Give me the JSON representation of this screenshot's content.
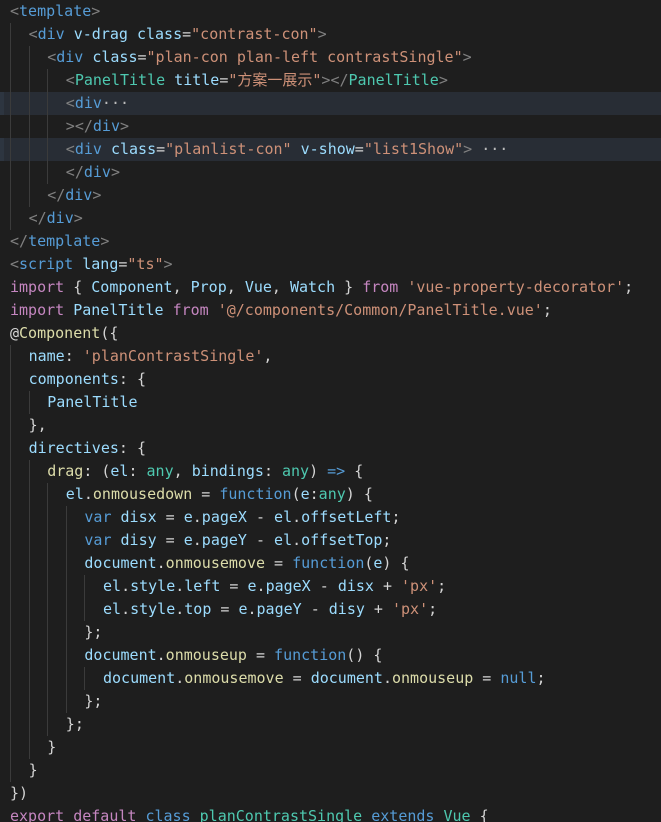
{
  "editor": {
    "lines": [
      {
        "indent": 0,
        "tokens": [
          [
            "punc",
            "<"
          ],
          [
            "tag",
            "template"
          ],
          [
            "punc",
            ">"
          ]
        ]
      },
      {
        "indent": 1,
        "tokens": [
          [
            "punc",
            "<"
          ],
          [
            "tag",
            "div"
          ],
          [
            "plain",
            " "
          ],
          [
            "attr",
            "v-drag"
          ],
          [
            "plain",
            " "
          ],
          [
            "attr",
            "class"
          ],
          [
            "plain",
            "="
          ],
          [
            "str",
            "\"contrast-con\""
          ],
          [
            "punc",
            ">"
          ]
        ]
      },
      {
        "indent": 2,
        "tokens": [
          [
            "punc",
            "<"
          ],
          [
            "tag",
            "div"
          ],
          [
            "plain",
            " "
          ],
          [
            "attr",
            "class"
          ],
          [
            "plain",
            "="
          ],
          [
            "str",
            "\"plan-con plan-left contrastSingle\""
          ],
          [
            "punc",
            ">"
          ]
        ]
      },
      {
        "indent": 3,
        "tokens": [
          [
            "punc",
            "<"
          ],
          [
            "comp",
            "PanelTitle"
          ],
          [
            "plain",
            " "
          ],
          [
            "attr",
            "title"
          ],
          [
            "plain",
            "="
          ],
          [
            "str",
            "\"方案一展示\""
          ],
          [
            "punc",
            "></"
          ],
          [
            "comp",
            "PanelTitle"
          ],
          [
            "punc",
            ">"
          ]
        ]
      },
      {
        "indent": 3,
        "current": true,
        "tokens": [
          [
            "punc",
            "<"
          ],
          [
            "tag",
            "div"
          ],
          [
            "fold",
            "···"
          ]
        ]
      },
      {
        "indent": 3,
        "tokens": [
          [
            "punc",
            "></"
          ],
          [
            "tag",
            "div"
          ],
          [
            "punc",
            ">"
          ]
        ]
      },
      {
        "indent": 3,
        "current": true,
        "tokens": [
          [
            "punc",
            "<"
          ],
          [
            "tag",
            "div"
          ],
          [
            "plain",
            " "
          ],
          [
            "attr",
            "class"
          ],
          [
            "plain",
            "="
          ],
          [
            "str",
            "\"planlist-con\""
          ],
          [
            "plain",
            " "
          ],
          [
            "attr",
            "v-show"
          ],
          [
            "plain",
            "="
          ],
          [
            "str",
            "\"list1Show\""
          ],
          [
            "punc",
            ">"
          ],
          [
            "fold",
            " ···"
          ]
        ]
      },
      {
        "indent": 3,
        "tokens": [
          [
            "punc",
            "</"
          ],
          [
            "tag",
            "div"
          ],
          [
            "punc",
            ">"
          ]
        ]
      },
      {
        "indent": 2,
        "tokens": [
          [
            "punc",
            "</"
          ],
          [
            "tag",
            "div"
          ],
          [
            "punc",
            ">"
          ]
        ]
      },
      {
        "indent": 1,
        "tokens": [
          [
            "punc",
            "</"
          ],
          [
            "tag",
            "div"
          ],
          [
            "punc",
            ">"
          ]
        ]
      },
      {
        "indent": 0,
        "tokens": [
          [
            "punc",
            "</"
          ],
          [
            "tag",
            "template"
          ],
          [
            "punc",
            ">"
          ]
        ]
      },
      {
        "indent": 0,
        "tokens": [
          [
            "punc",
            "<"
          ],
          [
            "tag",
            "script"
          ],
          [
            "plain",
            " "
          ],
          [
            "attr",
            "lang"
          ],
          [
            "plain",
            "="
          ],
          [
            "str",
            "\"ts\""
          ],
          [
            "punc",
            ">"
          ]
        ]
      },
      {
        "indent": 0,
        "tokens": [
          [
            "kw",
            "import"
          ],
          [
            "plain",
            " { "
          ],
          [
            "ident",
            "Component"
          ],
          [
            "plain",
            ", "
          ],
          [
            "ident",
            "Prop"
          ],
          [
            "plain",
            ", "
          ],
          [
            "ident",
            "Vue"
          ],
          [
            "plain",
            ", "
          ],
          [
            "ident",
            "Watch"
          ],
          [
            "plain",
            " } "
          ],
          [
            "kw",
            "from"
          ],
          [
            "plain",
            " "
          ],
          [
            "str",
            "'vue-property-decorator'"
          ],
          [
            "plain",
            ";"
          ]
        ]
      },
      {
        "indent": 0,
        "tokens": [
          [
            "kw",
            "import"
          ],
          [
            "plain",
            " "
          ],
          [
            "ident",
            "PanelTitle"
          ],
          [
            "plain",
            " "
          ],
          [
            "kw",
            "from"
          ],
          [
            "plain",
            " "
          ],
          [
            "str",
            "'@/components/Common/PanelTitle.vue'"
          ],
          [
            "plain",
            ";"
          ]
        ]
      },
      {
        "indent": 0,
        "tokens": [
          [
            "plain",
            "@"
          ],
          [
            "fn",
            "Component"
          ],
          [
            "plain",
            "({"
          ]
        ]
      },
      {
        "indent": 1,
        "tokens": [
          [
            "ident",
            "name"
          ],
          [
            "plain",
            ": "
          ],
          [
            "str",
            "'planContrastSingle'"
          ],
          [
            "plain",
            ","
          ]
        ]
      },
      {
        "indent": 1,
        "tokens": [
          [
            "ident",
            "components"
          ],
          [
            "plain",
            ": {"
          ]
        ]
      },
      {
        "indent": 2,
        "tokens": [
          [
            "ident",
            "PanelTitle"
          ]
        ]
      },
      {
        "indent": 1,
        "tokens": [
          [
            "plain",
            "},"
          ]
        ]
      },
      {
        "indent": 1,
        "tokens": [
          [
            "ident",
            "directives"
          ],
          [
            "plain",
            ": {"
          ]
        ]
      },
      {
        "indent": 2,
        "tokens": [
          [
            "fn",
            "drag"
          ],
          [
            "plain",
            ": ("
          ],
          [
            "ident",
            "el"
          ],
          [
            "plain",
            ": "
          ],
          [
            "type",
            "any"
          ],
          [
            "plain",
            ", "
          ],
          [
            "ident",
            "bindings"
          ],
          [
            "plain",
            ": "
          ],
          [
            "type",
            "any"
          ],
          [
            "plain",
            ") "
          ],
          [
            "kw2",
            "=>"
          ],
          [
            "plain",
            " {"
          ]
        ]
      },
      {
        "indent": 3,
        "tokens": [
          [
            "ident",
            "el"
          ],
          [
            "plain",
            "."
          ],
          [
            "fn",
            "onmousedown"
          ],
          [
            "plain",
            " = "
          ],
          [
            "kw2",
            "function"
          ],
          [
            "plain",
            "("
          ],
          [
            "ident",
            "e"
          ],
          [
            "plain",
            ":"
          ],
          [
            "type",
            "any"
          ],
          [
            "plain",
            ") {"
          ]
        ]
      },
      {
        "indent": 4,
        "tokens": [
          [
            "kw2",
            "var"
          ],
          [
            "plain",
            " "
          ],
          [
            "ident",
            "disx"
          ],
          [
            "plain",
            " = "
          ],
          [
            "ident",
            "e"
          ],
          [
            "plain",
            "."
          ],
          [
            "ident",
            "pageX"
          ],
          [
            "plain",
            " - "
          ],
          [
            "ident",
            "el"
          ],
          [
            "plain",
            "."
          ],
          [
            "ident",
            "offsetLeft"
          ],
          [
            "plain",
            ";"
          ]
        ]
      },
      {
        "indent": 4,
        "tokens": [
          [
            "kw2",
            "var"
          ],
          [
            "plain",
            " "
          ],
          [
            "ident",
            "disy"
          ],
          [
            "plain",
            " = "
          ],
          [
            "ident",
            "e"
          ],
          [
            "plain",
            "."
          ],
          [
            "ident",
            "pageY"
          ],
          [
            "plain",
            " - "
          ],
          [
            "ident",
            "el"
          ],
          [
            "plain",
            "."
          ],
          [
            "ident",
            "offsetTop"
          ],
          [
            "plain",
            ";"
          ]
        ]
      },
      {
        "indent": 4,
        "tokens": [
          [
            "ident",
            "document"
          ],
          [
            "plain",
            "."
          ],
          [
            "fn",
            "onmousemove"
          ],
          [
            "plain",
            " = "
          ],
          [
            "kw2",
            "function"
          ],
          [
            "plain",
            "("
          ],
          [
            "ident",
            "e"
          ],
          [
            "plain",
            ") {"
          ]
        ]
      },
      {
        "indent": 5,
        "tokens": [
          [
            "ident",
            "el"
          ],
          [
            "plain",
            "."
          ],
          [
            "ident",
            "style"
          ],
          [
            "plain",
            "."
          ],
          [
            "ident",
            "left"
          ],
          [
            "plain",
            " = "
          ],
          [
            "ident",
            "e"
          ],
          [
            "plain",
            "."
          ],
          [
            "ident",
            "pageX"
          ],
          [
            "plain",
            " - "
          ],
          [
            "ident",
            "disx"
          ],
          [
            "plain",
            " + "
          ],
          [
            "str",
            "'px'"
          ],
          [
            "plain",
            ";"
          ]
        ]
      },
      {
        "indent": 5,
        "tokens": [
          [
            "ident",
            "el"
          ],
          [
            "plain",
            "."
          ],
          [
            "ident",
            "style"
          ],
          [
            "plain",
            "."
          ],
          [
            "ident",
            "top"
          ],
          [
            "plain",
            " = "
          ],
          [
            "ident",
            "e"
          ],
          [
            "plain",
            "."
          ],
          [
            "ident",
            "pageY"
          ],
          [
            "plain",
            " - "
          ],
          [
            "ident",
            "disy"
          ],
          [
            "plain",
            " + "
          ],
          [
            "str",
            "'px'"
          ],
          [
            "plain",
            ";"
          ]
        ]
      },
      {
        "indent": 4,
        "tokens": [
          [
            "plain",
            "};"
          ]
        ]
      },
      {
        "indent": 4,
        "tokens": [
          [
            "ident",
            "document"
          ],
          [
            "plain",
            "."
          ],
          [
            "fn",
            "onmouseup"
          ],
          [
            "plain",
            " = "
          ],
          [
            "kw2",
            "function"
          ],
          [
            "plain",
            "() {"
          ]
        ]
      },
      {
        "indent": 5,
        "tokens": [
          [
            "ident",
            "document"
          ],
          [
            "plain",
            "."
          ],
          [
            "fn",
            "onmousemove"
          ],
          [
            "plain",
            " = "
          ],
          [
            "ident",
            "document"
          ],
          [
            "plain",
            "."
          ],
          [
            "fn",
            "onmouseup"
          ],
          [
            "plain",
            " = "
          ],
          [
            "kw2",
            "null"
          ],
          [
            "plain",
            ";"
          ]
        ]
      },
      {
        "indent": 4,
        "tokens": [
          [
            "plain",
            "};"
          ]
        ]
      },
      {
        "indent": 3,
        "tokens": [
          [
            "plain",
            "};"
          ]
        ]
      },
      {
        "indent": 2,
        "tokens": [
          [
            "plain",
            "}"
          ]
        ]
      },
      {
        "indent": 1,
        "tokens": [
          [
            "plain",
            "}"
          ]
        ]
      },
      {
        "indent": 0,
        "tokens": [
          [
            "plain",
            "})"
          ]
        ]
      },
      {
        "indent": 0,
        "tokens": [
          [
            "kw",
            "export"
          ],
          [
            "plain",
            " "
          ],
          [
            "kw",
            "default"
          ],
          [
            "plain",
            " "
          ],
          [
            "kw2",
            "class"
          ],
          [
            "plain",
            " "
          ],
          [
            "type",
            "planContrastSingle"
          ],
          [
            "plain",
            " "
          ],
          [
            "kw2",
            "extends"
          ],
          [
            "plain",
            " "
          ],
          [
            "type",
            "Vue"
          ],
          [
            "plain",
            " {"
          ]
        ]
      }
    ]
  }
}
